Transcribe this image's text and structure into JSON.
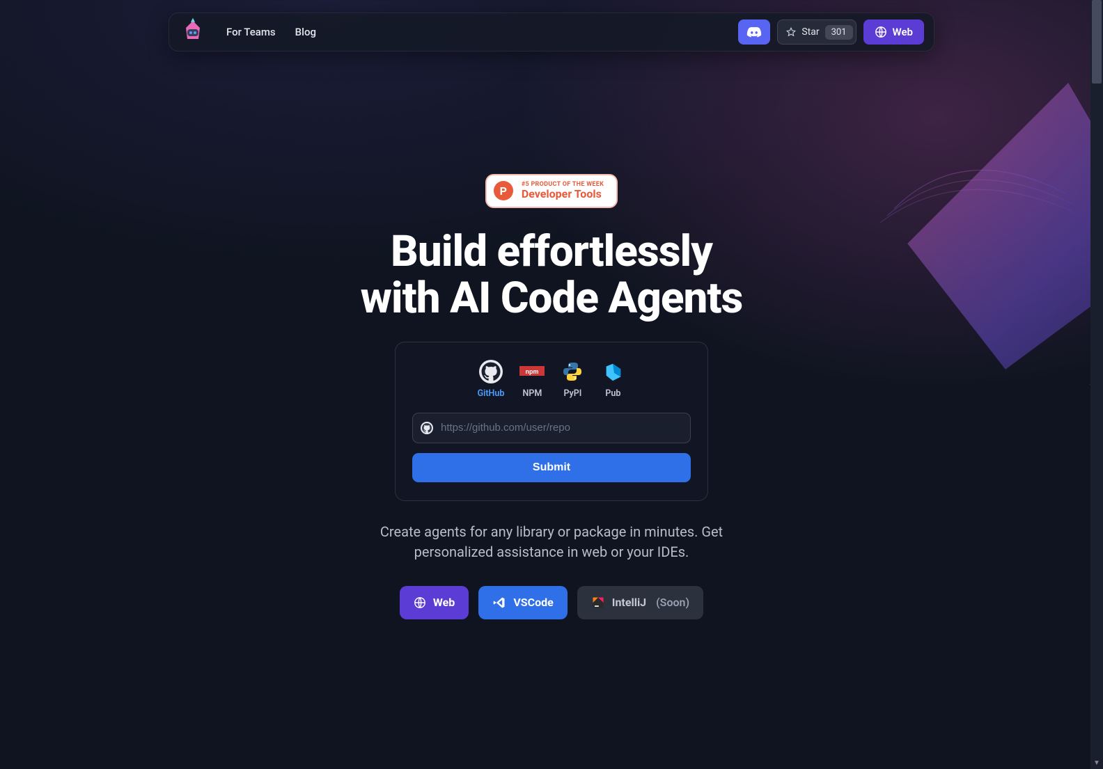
{
  "nav": {
    "links": [
      "For Teams",
      "Blog"
    ],
    "star_label": "Star",
    "star_count": "301",
    "web_label": "Web"
  },
  "ph_badge": {
    "icon_letter": "P",
    "sub": "#5 PRODUCT OF THE WEEK",
    "main": "Developer Tools"
  },
  "headline_l1": "Build effortlessly",
  "headline_l2": "with AI Code Agents",
  "sources": [
    {
      "key": "github",
      "label": "GitHub",
      "active": true
    },
    {
      "key": "npm",
      "label": "NPM",
      "active": false
    },
    {
      "key": "pypi",
      "label": "PyPI",
      "active": false
    },
    {
      "key": "pub",
      "label": "Pub",
      "active": false
    }
  ],
  "url_placeholder": "https://github.com/user/repo",
  "submit_label": "Submit",
  "sub_copy": "Create agents for any library or package in minutes. Get personalized assistance in web or your IDEs.",
  "cta": {
    "web": "Web",
    "vscode": "VSCode",
    "intellij": "IntelliJ",
    "intellij_soon": "(Soon)"
  }
}
